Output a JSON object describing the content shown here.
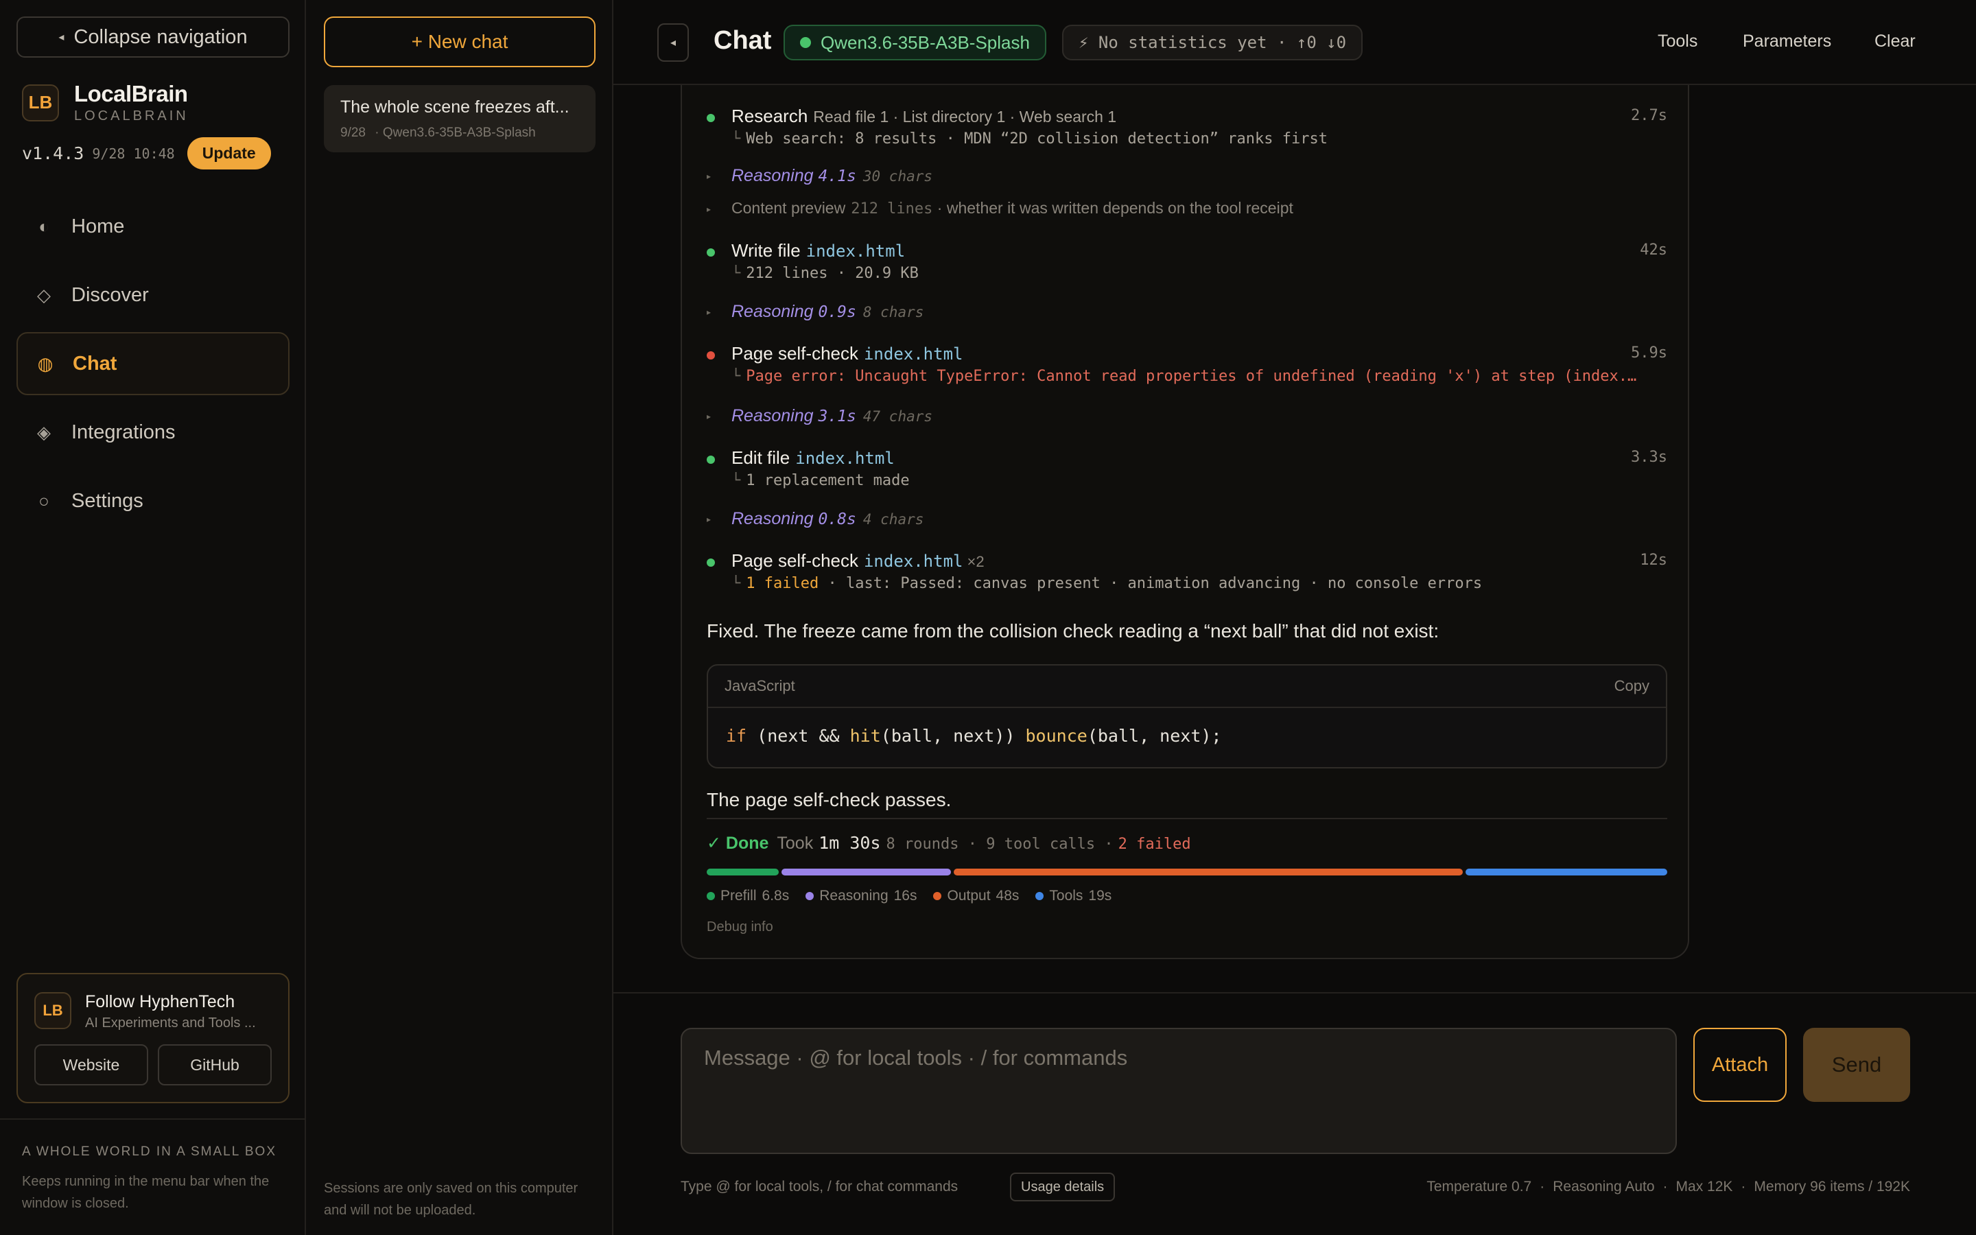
{
  "nav": {
    "collapse_label": "Collapse navigation",
    "brand_name": "LocalBrain",
    "brand_sub": "LOCALBRAIN",
    "logo_text": "LB",
    "version": "v1.4.3",
    "version_date": "9/28 10:48",
    "update_label": "Update",
    "items": [
      {
        "label": "Home",
        "icon": "half-circle-icon"
      },
      {
        "label": "Discover",
        "icon": "diamond-icon"
      },
      {
        "label": "Chat",
        "icon": "globe-icon"
      },
      {
        "label": "Integrations",
        "icon": "layered-diamond-icon"
      },
      {
        "label": "Settings",
        "icon": "circle-icon"
      }
    ],
    "active_item": "Chat",
    "follow": {
      "logo_text": "LB",
      "title": "Follow HyphenTech",
      "subtitle": "AI Experiments and Tools ...",
      "website_label": "Website",
      "github_label": "GitHub"
    },
    "tagline": "A WHOLE WORLD IN A SMALL BOX",
    "tagline_sub": "Keeps running in the menu bar when the window is closed."
  },
  "sessions": {
    "new_chat_label": "+ New chat",
    "items": [
      {
        "title": "The whole scene freezes aft...",
        "date": "9/28",
        "model": "· Qwen3.6-35B-A3B-Splash"
      }
    ],
    "note": "Sessions are only saved on this computer and will not be uploaded."
  },
  "header": {
    "title": "Chat",
    "model": "Qwen3.6-35B-A3B-Splash",
    "stats": "⚡ No statistics yet · ↑0 ↓0",
    "tools_label": "Tools",
    "parameters_label": "Parameters",
    "clear_label": "Clear"
  },
  "transcript": {
    "steps": [
      {
        "title": "Research",
        "meta": "Read file 1 · List directory 1 · Web search 1",
        "duration": "2.7s",
        "detail": "Web search: 8 results · MDN “2D collision detection” ranks first",
        "status": "ok"
      },
      {
        "title": "Write file",
        "file": "index.html",
        "duration": "42s",
        "detail": "212 lines · 20.9 KB",
        "status": "ok"
      },
      {
        "title": "Page self-check",
        "file": "index.html",
        "duration": "5.9s",
        "detail": "Page error: Uncaught TypeError: Cannot read properties of undefined (reading 'x') at step (index.html:...)",
        "status": "error"
      },
      {
        "title": "Edit file",
        "file": "index.html",
        "duration": "3.3s",
        "detail": "1 replacement made",
        "status": "ok"
      },
      {
        "title": "Page self-check",
        "file": "index.html",
        "multiplier": "×2",
        "duration": "12s",
        "detail_warn": "1 failed",
        "detail": " · last: Passed: canvas present · animation advancing · no console errors",
        "status": "ok"
      }
    ],
    "reasoning": [
      {
        "label": "Reasoning",
        "time": "4.1s",
        "chars": "30 chars"
      },
      {
        "label": "Reasoning",
        "time": "0.9s",
        "chars": "8 chars"
      },
      {
        "label": "Reasoning",
        "time": "3.1s",
        "chars": "47 chars"
      },
      {
        "label": "Reasoning",
        "time": "0.8s",
        "chars": "4 chars"
      }
    ],
    "preview": {
      "label": "Content preview",
      "lines": "212 lines",
      "note": " · whether it was written depends on the tool receipt"
    },
    "answer_intro": "Fixed. The freeze came from the collision check reading a “next ball” that did not exist:",
    "code": {
      "language": "JavaScript",
      "copy_label": "Copy",
      "tokens": {
        "kw": "if",
        "p1": " (next && ",
        "fn1": "hit",
        "p2": "(ball, next)) ",
        "fn2": "bounce",
        "p3": "(ball, next);"
      }
    },
    "answer_outro": "The page self-check passes.",
    "done": {
      "label": "✓ Done",
      "took_label": "Took",
      "took": "1m 30s",
      "rest": "8 rounds · 9 tool calls ·",
      "failed": "2 failed"
    },
    "timing": [
      {
        "name": "Prefill",
        "value": "6.8s",
        "seconds": 6.8,
        "color": "#22a35a"
      },
      {
        "name": "Reasoning",
        "value": "16s",
        "seconds": 16,
        "color": "#9a83e8"
      },
      {
        "name": "Output",
        "value": "48s",
        "seconds": 48,
        "color": "#e0602a"
      },
      {
        "name": "Tools",
        "value": "19s",
        "seconds": 19,
        "color": "#3f86e6"
      }
    ],
    "debug_label": "Debug info"
  },
  "composer": {
    "placeholder": "Message · @ for local tools · / for commands",
    "attach_label": "Attach",
    "send_label": "Send",
    "hint": "Type @ for local tools, / for chat commands",
    "usage_label": "Usage details",
    "temperature": "Temperature 0.7",
    "reasoning": "Reasoning Auto",
    "max": "Max 12K",
    "memory": "Memory 96 items / 192K"
  }
}
